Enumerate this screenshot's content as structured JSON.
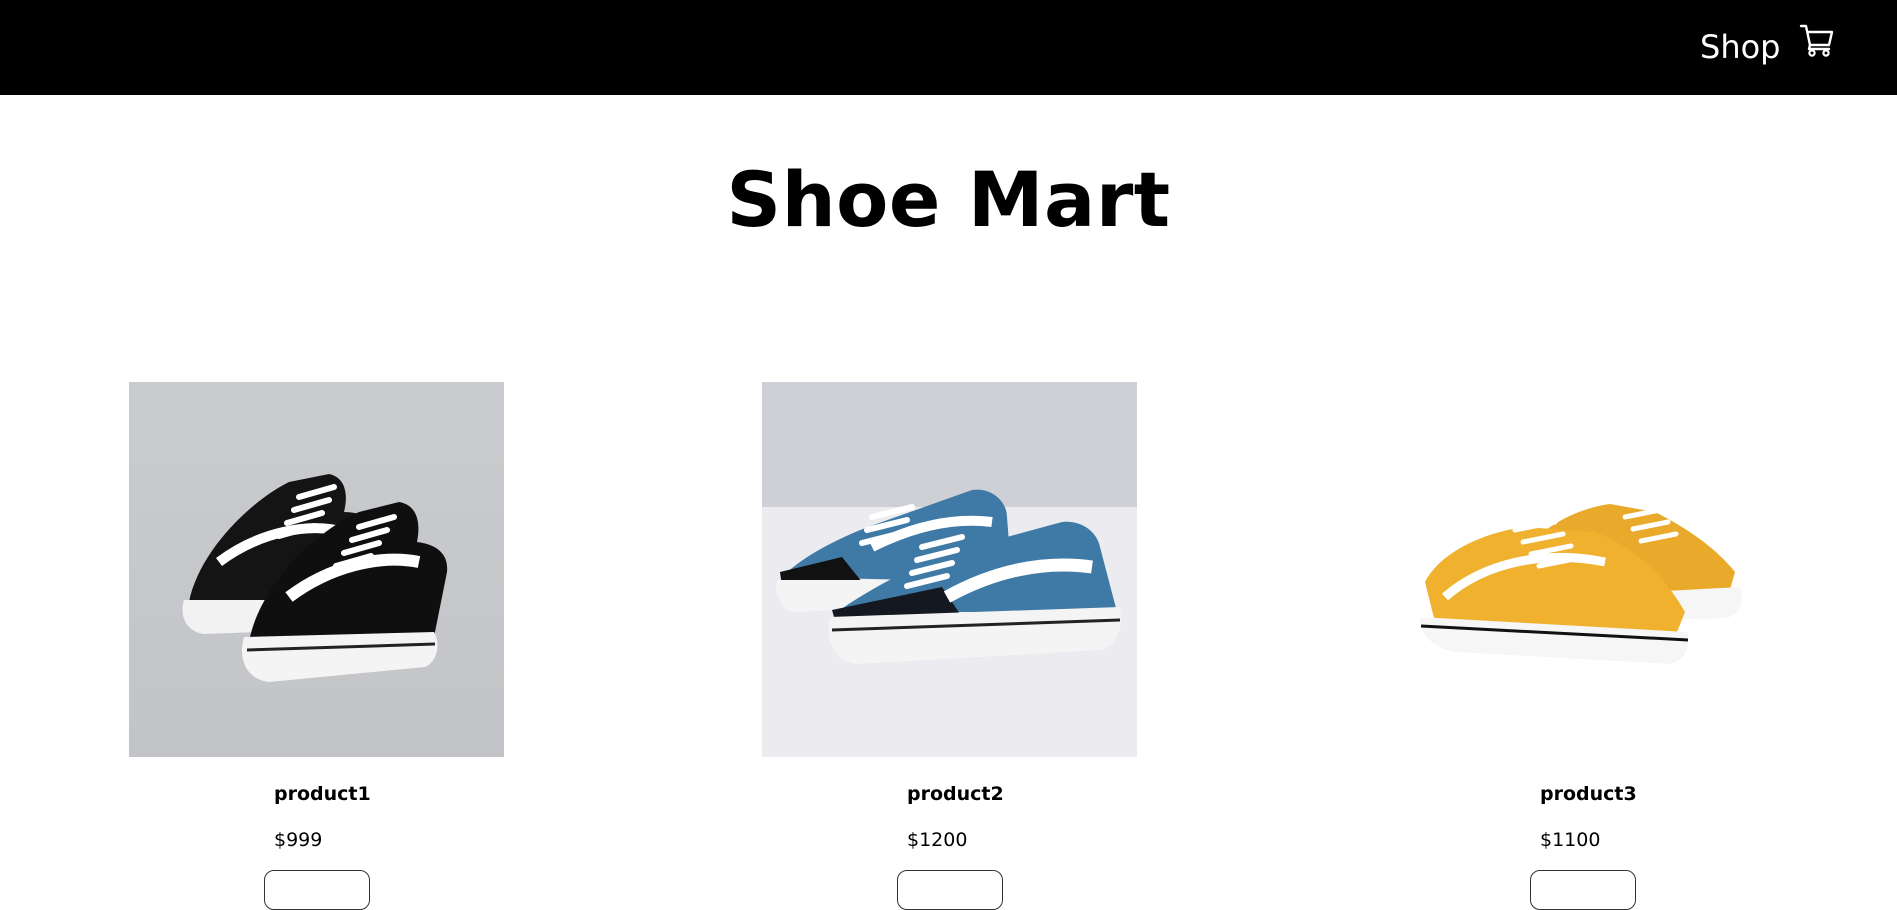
{
  "nav": {
    "shop_label": "Shop",
    "cart_icon": "cart-icon"
  },
  "page": {
    "title": "Shoe Mart"
  },
  "products": [
    {
      "name": "product1",
      "price": "$999",
      "image_icon": "shoe-image-black",
      "color": "#1a1a1a"
    },
    {
      "name": "product2",
      "price": "$1200",
      "image_icon": "shoe-image-blue",
      "color": "#3f7aa6"
    },
    {
      "name": "product3",
      "price": "$1100",
      "image_icon": "shoe-image-yellow",
      "color": "#e6a626"
    }
  ]
}
